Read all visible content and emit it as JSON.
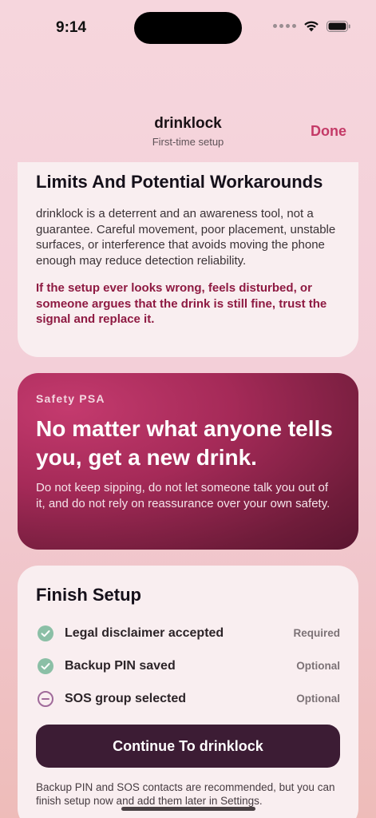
{
  "status": {
    "time": "9:14"
  },
  "nav": {
    "title": "drinklock",
    "subtitle": "First-time setup",
    "done_label": "Done"
  },
  "limits": {
    "title": "Limits And Potential Workarounds",
    "body": "drinklock is a deterrent and an awareness tool, not a guarantee. Careful movement, poor placement, unstable surfaces, or interference that avoids moving the phone enough may reduce detection reliability.",
    "warning": "If the setup ever looks wrong, feels disturbed, or someone argues that the drink is still fine, trust the signal and replace it."
  },
  "psa": {
    "label": "Safety PSA",
    "headline": "No matter what anyone tells you, get a new drink.",
    "body": "Do not keep sipping, do not let someone talk you out of it, and do not rely on reassurance over your own safety."
  },
  "finish": {
    "title": "Finish Setup",
    "items": [
      {
        "label": "Legal disclaimer accepted",
        "tag": "Required",
        "icon": "check-circle-icon",
        "state": "done"
      },
      {
        "label": "Backup PIN saved",
        "tag": "Optional",
        "icon": "check-circle-icon",
        "state": "done"
      },
      {
        "label": "SOS group selected",
        "tag": "Optional",
        "icon": "minus-circle-icon",
        "state": "pending"
      }
    ],
    "continue_label": "Continue To drinklock",
    "note": "Backup PIN and SOS contacts are recommended, but you can finish setup now and add them later in Settings."
  },
  "colors": {
    "accent": "#c43a67",
    "warning": "#8e1a42",
    "check": "#8bbfa6",
    "pending": "#a06a9a",
    "button": "#3c1c34"
  }
}
